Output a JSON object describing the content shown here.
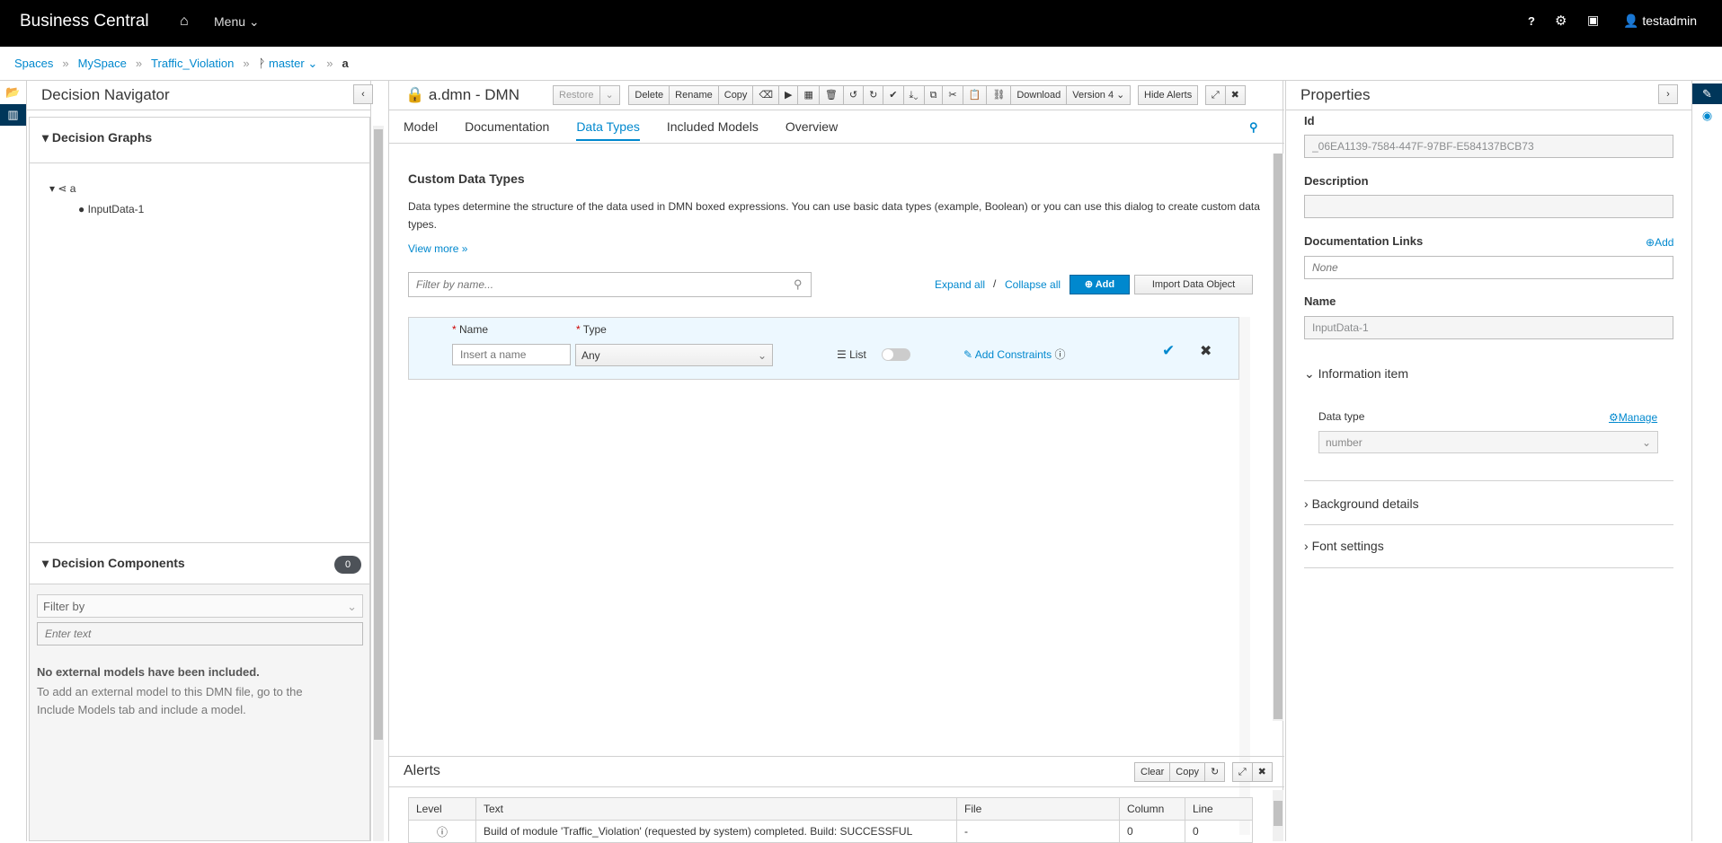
{
  "topbar": {
    "brand": "Business Central",
    "menu": "Menu",
    "help": "?",
    "user": "testadmin"
  },
  "breadcrumb": [
    "Spaces",
    "MySpace",
    "Traffic_Violation",
    "master",
    "a"
  ],
  "navigator": {
    "title": "Decision Navigator",
    "graphs_title": "Decision Graphs",
    "tree_root": "a",
    "tree_child": "InputData-1",
    "components_title": "Decision Components",
    "components_count": "0",
    "filter_by": "Filter by",
    "enter_text": "Enter text",
    "empty_title": "No external models have been included.",
    "empty_text": "To add an external model to this DMN file, go to the Include Models tab and include a model."
  },
  "editor": {
    "title": "a.dmn - DMN",
    "toolbar": {
      "restore": "Restore",
      "delete": "Delete",
      "rename": "Rename",
      "copy": "Copy",
      "download": "Download",
      "version": "Version 4",
      "hide_alerts": "Hide Alerts"
    },
    "tabs": [
      "Model",
      "Documentation",
      "Data Types",
      "Included Models",
      "Overview"
    ],
    "active_tab": "Data Types"
  },
  "datatypes": {
    "heading": "Custom Data Types",
    "description": "Data types determine the structure of the data used in DMN boxed expressions. You can use basic data types (example, Boolean) or you can use this dialog to create custom data types.",
    "view_more": "View more »",
    "filter_placeholder": "Filter by name...",
    "expand_all": "Expand all",
    "separator": "/",
    "collapse_all": "Collapse all",
    "add": "Add",
    "import": "Import Data Object",
    "row": {
      "name_label": "Name",
      "type_label": "Type",
      "name_placeholder": "Insert a name",
      "type_value": "Any",
      "list_label": "List",
      "list_on": false,
      "add_constraints": "Add Constraints"
    }
  },
  "alerts": {
    "title": "Alerts",
    "clear": "Clear",
    "copy": "Copy",
    "columns": [
      "Level",
      "Text",
      "File",
      "Column",
      "Line"
    ],
    "rows": [
      {
        "text": "Build of module 'Traffic_Violation' (requested by system) completed. Build: SUCCESSFUL",
        "file": "-",
        "column": "0",
        "line": "0"
      }
    ]
  },
  "properties": {
    "title": "Properties",
    "id_label": "Id",
    "id_value": "_06EA1139-7584-447F-97BF-E584137BCB73",
    "description_label": "Description",
    "description_value": "",
    "doc_links_label": "Documentation Links",
    "doc_links_add": "Add",
    "doc_links_placeholder": "None",
    "name_label": "Name",
    "name_value": "InputData-1",
    "info_item": "Information item",
    "data_type_label": "Data type",
    "manage": "Manage",
    "data_type_value": "number",
    "background": "Background details",
    "font": "Font settings"
  },
  "colors": {
    "accent": "#0088ce",
    "topbar": "#000000",
    "row_highlight": "#edf8ff"
  }
}
